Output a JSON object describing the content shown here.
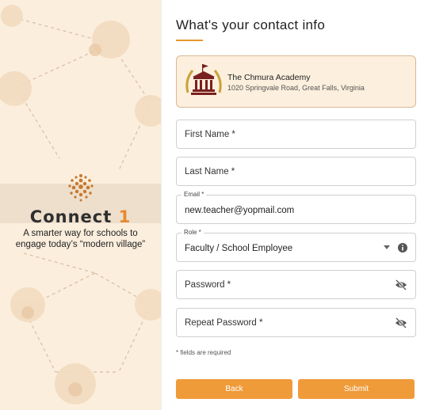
{
  "promo": {
    "logo_word": "Connect",
    "logo_number": "1",
    "tagline_line1": "A smarter way for schools to",
    "tagline_line2": "engage today’s “modern village”"
  },
  "form": {
    "title": "What's your contact info",
    "school": {
      "name": "The Chmura Academy",
      "address": "1020 Springvale Road, Great Falls, Virginia"
    },
    "first_name": {
      "placeholder": "First Name *"
    },
    "last_name": {
      "placeholder": "Last Name *"
    },
    "email": {
      "label": "Email *",
      "value": "new.teacher@yopmail.com"
    },
    "role": {
      "label": "Role *",
      "value": "Faculty / School Employee"
    },
    "password": {
      "placeholder": "Password *"
    },
    "repeat_password": {
      "placeholder": "Repeat Password *"
    },
    "required_note": "* fields are required",
    "back_label": "Back",
    "submit_label": "Submit"
  },
  "colors": {
    "accent": "#f09b3a",
    "panel_bg": "#fbeedd",
    "card_bg": "#fcefdd"
  },
  "icons": [
    "connect-logo-icon",
    "school-crest-icon",
    "dropdown-caret-icon",
    "info-icon",
    "eye-off-icon"
  ]
}
